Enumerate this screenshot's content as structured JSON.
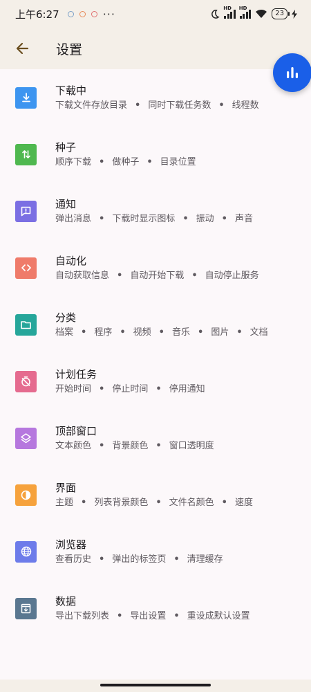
{
  "status_bar": {
    "time": "上午6:27",
    "battery": "23"
  },
  "app_bar": {
    "title": "设置"
  },
  "colors": {
    "download": "#3d95f0",
    "torrent": "#4fb84f",
    "notify": "#7b6fe3",
    "automation": "#ef7b6a",
    "category": "#26a69a",
    "schedule": "#e56b8f",
    "top_window": "#b678de",
    "interface": "#f6a23c",
    "browser": "#6d7cea",
    "data": "#5a7790"
  },
  "items": [
    {
      "title": "下载中",
      "subs": [
        "下载文件存放目录",
        "同时下载任务数",
        "线程数"
      ]
    },
    {
      "title": "种子",
      "subs": [
        "顺序下载",
        "做种子",
        "目录位置"
      ]
    },
    {
      "title": "通知",
      "subs": [
        "弹出消息",
        "下载时显示图标",
        "振动",
        "声音"
      ]
    },
    {
      "title": "自动化",
      "subs": [
        "自动获取信息",
        "自动开始下载",
        "自动停止服务"
      ]
    },
    {
      "title": "分类",
      "subs": [
        "档案",
        "程序",
        "视频",
        "音乐",
        "图片",
        "文档"
      ]
    },
    {
      "title": "计划任务",
      "subs": [
        "开始时间",
        "停止时间",
        "停用通知"
      ]
    },
    {
      "title": "顶部窗口",
      "subs": [
        "文本颜色",
        "背景颜色",
        "窗口透明度"
      ]
    },
    {
      "title": "界面",
      "subs": [
        "主题",
        "列表背景颜色",
        "文件名颜色",
        "速度"
      ]
    },
    {
      "title": "浏览器",
      "subs": [
        "查看历史",
        "弹出的标签页",
        "清理缓存"
      ]
    },
    {
      "title": "数据",
      "subs": [
        "导出下载列表",
        "导出设置",
        "重设成默认设置"
      ]
    }
  ],
  "separator": "•"
}
